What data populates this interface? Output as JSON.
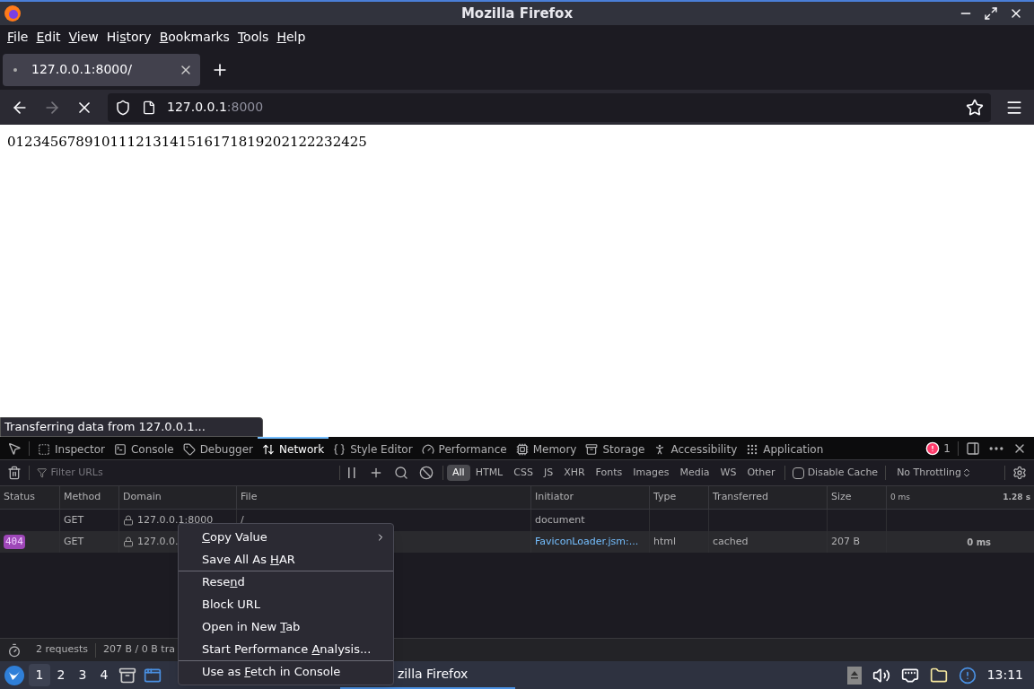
{
  "window": {
    "title": "Mozilla Firefox"
  },
  "menubar": [
    {
      "key": "F",
      "post": "ile"
    },
    {
      "key": "E",
      "post": "dit"
    },
    {
      "key": "V",
      "post": "iew"
    },
    {
      "pre": "Hi",
      "key": "s",
      "post": "tory"
    },
    {
      "key": "B",
      "post": "ookmarks"
    },
    {
      "key": "T",
      "post": "ools"
    },
    {
      "key": "H",
      "post": "elp"
    }
  ],
  "browser_tabs": [
    {
      "label": "127.0.0.1:8000/",
      "selected": true,
      "loading": true
    }
  ],
  "address": {
    "host": "127.0.0.1",
    "port": ":8000"
  },
  "page": {
    "text": "012345678910111213141516171819202122232425",
    "status": "Transferring data from 127.0.0.1..."
  },
  "devtools": {
    "tabs": [
      {
        "label": "Inspector",
        "selected": false
      },
      {
        "label": "Console",
        "selected": false
      },
      {
        "label": "Debugger",
        "selected": false
      },
      {
        "label": "Network",
        "selected": true
      },
      {
        "label": "Style Editor",
        "selected": false
      },
      {
        "label": "Performance",
        "selected": false
      },
      {
        "label": "Memory",
        "selected": false
      },
      {
        "label": "Storage",
        "selected": false
      },
      {
        "label": "Accessibility",
        "selected": false
      },
      {
        "label": "Application",
        "selected": false
      }
    ],
    "error_count": "1",
    "filter": {
      "placeholder": "Filter URLs"
    },
    "type_filters": [
      {
        "label": "All",
        "selected": true
      },
      {
        "label": "HTML",
        "selected": false
      },
      {
        "label": "CSS",
        "selected": false
      },
      {
        "label": "JS",
        "selected": false
      },
      {
        "label": "XHR",
        "selected": false
      },
      {
        "label": "Fonts",
        "selected": false
      },
      {
        "label": "Images",
        "selected": false
      },
      {
        "label": "Media",
        "selected": false
      },
      {
        "label": "WS",
        "selected": false
      },
      {
        "label": "Other",
        "selected": false
      }
    ],
    "disable_cache": {
      "label": "Disable Cache",
      "checked": false
    },
    "throttling": "No Throttling",
    "columns": [
      "Status",
      "Method",
      "Domain",
      "File",
      "Initiator",
      "Type",
      "Transferred",
      "Size"
    ],
    "timeline_ticks": [
      "0 ms",
      "1.28 s"
    ],
    "rows": [
      {
        "method": "GET",
        "domain": "127.0.0.1:8000",
        "file": "/",
        "initiator": "document",
        "initiator_link": false,
        "selected": false
      },
      {
        "status": "404",
        "method": "GET",
        "domain": "127.0.0.",
        "initiator": "FaviconLoader.jsm:...",
        "initiator_link": true,
        "type": "html",
        "transferred": "cached",
        "size": "207 B",
        "timing": "0 ms",
        "selected": true
      }
    ],
    "status_bar": {
      "requests": "2 requests",
      "transfer": "207 B / 0 B tra"
    }
  },
  "context_menu": [
    {
      "key": "C",
      "post": "opy Value",
      "submenu": true,
      "separator_before": false
    },
    {
      "pre": "Save All As ",
      "key": "H",
      "post": "AR",
      "submenu": false,
      "separator_before": false
    },
    {
      "pre": "Rese",
      "key": "n",
      "post": "d",
      "submenu": false,
      "separator_before": true
    },
    {
      "pre": "Block URL",
      "submenu": false,
      "separator_before": false
    },
    {
      "pre": "Open in New ",
      "key": "T",
      "post": "ab",
      "submenu": false,
      "separator_before": false
    },
    {
      "pre": "Start Performance ",
      "key": "A",
      "post": "nalysis...",
      "submenu": false,
      "separator_before": false
    },
    {
      "pre": "Use as ",
      "key": "F",
      "post": "etch in Console",
      "submenu": false,
      "separator_before": true
    }
  ],
  "taskbar": {
    "workspaces": [
      {
        "label": "1",
        "selected": true
      },
      {
        "label": "2",
        "selected": false
      },
      {
        "label": "3",
        "selected": false
      },
      {
        "label": "4",
        "selected": false
      }
    ],
    "tasks": [
      {
        "label": "zilla Firefox",
        "selected": true
      }
    ],
    "clock": "13:11"
  }
}
